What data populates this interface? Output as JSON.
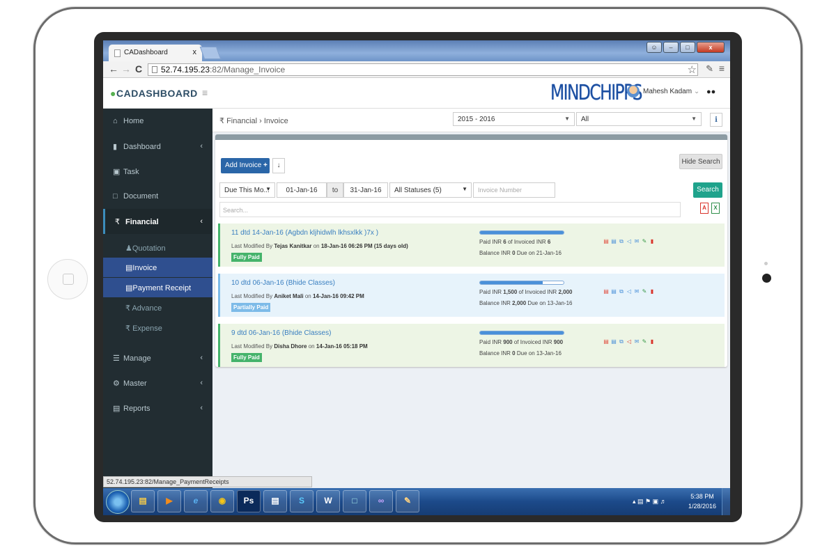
{
  "browser": {
    "tab_title": "CADashboard",
    "tab_close": "x",
    "url_host": "52.74.195.23",
    "url_path": ":82/Manage_Invoice",
    "status_url": "52.74.195.23:82/Manage_PaymentReceipts"
  },
  "header": {
    "logo": "CADASHBOARD",
    "brand": "MINDCHIPPS",
    "user_name": "Mahesh Kadam"
  },
  "sidebar": {
    "items": [
      {
        "label": "Home",
        "icon": "home-icon"
      },
      {
        "label": "Dashboard",
        "icon": "bar-chart-icon"
      },
      {
        "label": "Task",
        "icon": "calendar-icon"
      },
      {
        "label": "Document",
        "icon": "folder-icon"
      },
      {
        "label": "Financial",
        "icon": "rupee-icon"
      },
      {
        "label": "Manage",
        "icon": "list-icon"
      },
      {
        "label": "Master",
        "icon": "gear-icon"
      },
      {
        "label": "Reports",
        "icon": "file-pdf-icon"
      }
    ],
    "sub_items": [
      {
        "label": "Quotation"
      },
      {
        "label": "Invoice"
      },
      {
        "label": "Payment Receipt"
      },
      {
        "label": "Advance"
      },
      {
        "label": "Expense"
      }
    ]
  },
  "toolbar": {
    "breadcrumb_root": "Financial",
    "breadcrumb_current": "Invoice",
    "year": "2015 - 2016",
    "scope": "All",
    "info": "i"
  },
  "filters": {
    "add_label": "Add Invoice",
    "hide_search": "Hide Search",
    "due": "Due This Mo...",
    "from": "01-Jan-16",
    "to_label": "to",
    "to": "31-Jan-16",
    "status": "All Statuses (5)",
    "invoice_placeholder": "Invoice Number",
    "search_btn": "Search",
    "search_placeholder": "Search..."
  },
  "invoices": [
    {
      "title": "11 dtd 14-Jan-16 (Agbdn kljhidwlh lkhsxlkk )7x )",
      "modified_prefix": "Last Modified By",
      "modified_by": "Tejas Kanitkar",
      "modified_on": "on",
      "modified_date": "18-Jan-16 06:26 PM (15 days old)",
      "status": "Fully Paid",
      "status_color": "#45b36b",
      "paid_fraction": 1.0,
      "paid_text_a": "Paid INR",
      "paid_amount": "6",
      "paid_text_b": "of Invoiced INR",
      "invoiced_amount": "6",
      "bal_text_a": "Balance INR",
      "balance": "0",
      "bal_text_b": "Due on 21-Jan-16",
      "bg": "#edf5e5"
    },
    {
      "title": "10 dtd 06-Jan-16 (Bhide Classes)",
      "modified_prefix": "Last Modified By",
      "modified_by": "Aniket Mali",
      "modified_on": "on",
      "modified_date": "14-Jan-16 09:42 PM",
      "status": "Partially Paid",
      "status_color": "#7dbbe8",
      "paid_fraction": 0.75,
      "paid_text_a": "Paid INR",
      "paid_amount": "1,500",
      "paid_text_b": "of Invoiced INR",
      "invoiced_amount": "2,000",
      "bal_text_a": "Balance INR",
      "balance": "2,000",
      "bal_text_b": "Due on 13-Jan-16",
      "bg": "#e7f3fb"
    },
    {
      "title": "9 dtd 06-Jan-16 (Bhide Classes)",
      "modified_prefix": "Last Modified By",
      "modified_by": "Disha Dhore",
      "modified_on": "on",
      "modified_date": "14-Jan-16 05:18 PM",
      "status": "Fully Paid",
      "status_color": "#45b36b",
      "paid_fraction": 1.0,
      "paid_text_a": "Paid INR",
      "paid_amount": "900",
      "paid_text_b": "of Invoiced INR",
      "invoiced_amount": "900",
      "bal_text_a": "Balance INR",
      "balance": "0",
      "bal_text_b": "Due on 13-Jan-16",
      "bg": "#edf5e5"
    }
  ],
  "taskbar": {
    "apps": [
      "windows-explorer-icon",
      "media-player-icon",
      "ie-icon",
      "chrome-icon",
      "photoshop-icon",
      "cmd-icon",
      "skype-icon",
      "word-icon",
      "notepad-icon",
      "visual-studio-icon",
      "paint-icon"
    ],
    "time": "5:38 PM",
    "date": "1/28/2016"
  }
}
